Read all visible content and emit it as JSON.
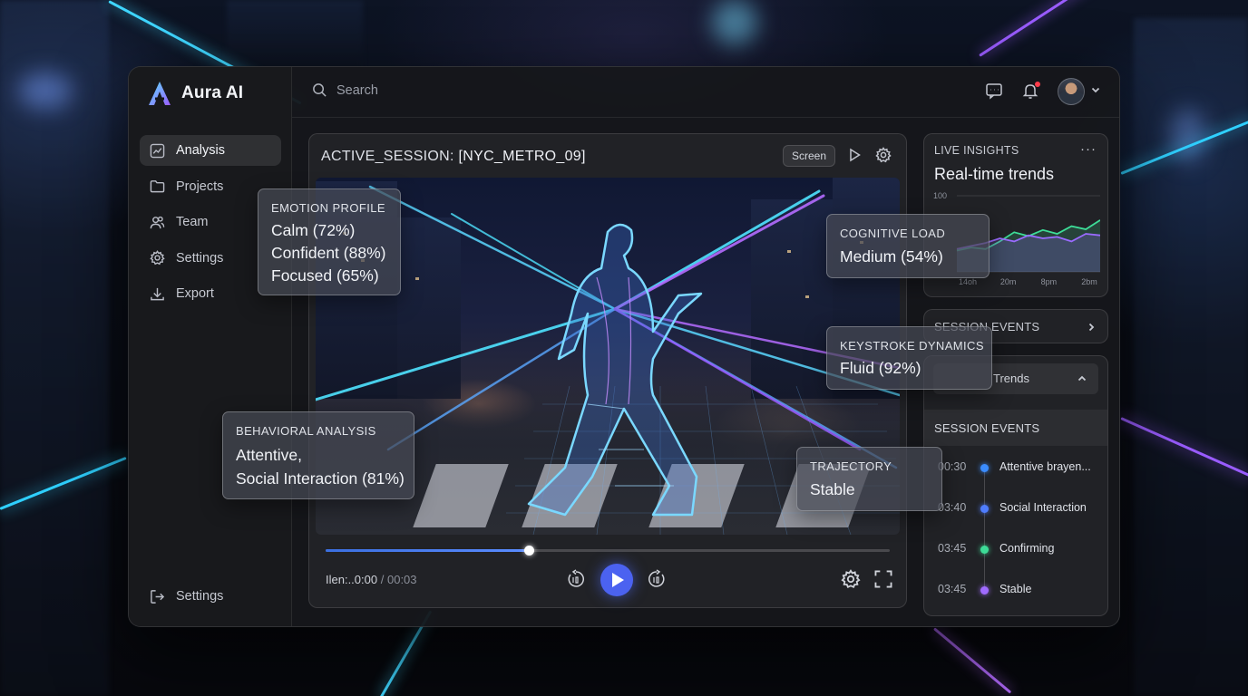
{
  "app": {
    "name": "Aura AI"
  },
  "sidebar": {
    "items": [
      {
        "label": "Analysis",
        "icon": "chart-icon",
        "active": true
      },
      {
        "label": "Projects",
        "icon": "folder-icon"
      },
      {
        "label": "Team",
        "icon": "users-icon"
      },
      {
        "label": "Settings",
        "icon": "gear-icon"
      },
      {
        "label": "Export",
        "icon": "download-icon"
      }
    ],
    "bottom": {
      "label": "Settings",
      "icon": "logout-icon"
    }
  },
  "header": {
    "search_placeholder": "Search",
    "icons": [
      "chat-icon",
      "bell-icon",
      "avatar",
      "chevron-down-icon"
    ]
  },
  "session": {
    "title_prefix": "ACTIVE_SESSION:",
    "title_value": "[NYC_METRO_09]",
    "screen_label": "Screen",
    "progress": 0.36,
    "time_current": "Ilen:..0:00",
    "time_separator": "/",
    "time_total": "00:03"
  },
  "overlays": {
    "emotion": {
      "label": "EMOTION PROFILE",
      "lines": [
        "Calm (72%)",
        "Confident (88%)",
        "Focused (65%)"
      ]
    },
    "cognitive": {
      "label": "COGNITIVE LOAD",
      "value": "Medium (54%)"
    },
    "keystroke": {
      "label": "KEYSTROKE DYNAMICS",
      "value": "Fluid (92%)"
    },
    "behavioral": {
      "label": "BEHAVIORAL ANALYSIS",
      "lines": [
        "Attentive,",
        "Social Interaction (81%)"
      ]
    },
    "trajectory": {
      "label": "TRAJECTORY",
      "value": "Stable"
    }
  },
  "insights": {
    "label": "LIVE INSIGHTS",
    "title": "Real-time trends",
    "more": "···",
    "chart_data": {
      "type": "line",
      "y_tick": "100",
      "x_ticks": [
        "14oh",
        "20m",
        "8pm",
        "2bm"
      ],
      "series": [
        {
          "color": "#3ddc97",
          "values": [
            28,
            32,
            30,
            40,
            52,
            47,
            55,
            50,
            60,
            56,
            68
          ]
        },
        {
          "color": "#9a6bff",
          "values": [
            30,
            34,
            38,
            44,
            40,
            48,
            44,
            46,
            40,
            50,
            48
          ]
        }
      ]
    }
  },
  "events_collapsed": {
    "label": "SESSION EVENTS"
  },
  "events": {
    "trends_label": "Trends",
    "label": "SESSION EVENTS",
    "items": [
      {
        "time": "00:30",
        "text": "Attentive brayen...",
        "color": "#3b8cff"
      },
      {
        "time": "03:40",
        "text": "Social Interaction",
        "color": "#4f7dff"
      },
      {
        "time": "03:45",
        "text": "Confirming",
        "color": "#3ddc97"
      },
      {
        "time": "03:45",
        "text": "Stable",
        "color": "#a06bff"
      }
    ]
  }
}
